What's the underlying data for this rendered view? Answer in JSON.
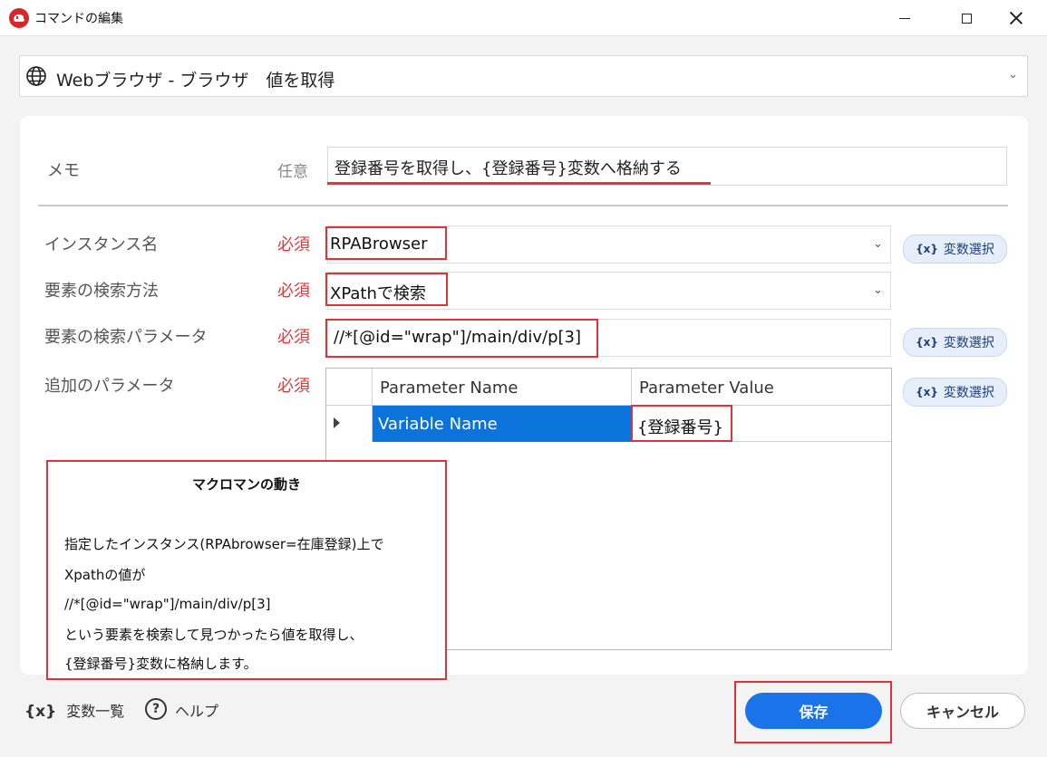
{
  "window": {
    "title": "コマンドの編集"
  },
  "command": {
    "label": "Webブラウザ - ブラウザ　値を取得"
  },
  "memo": {
    "label": "メモ",
    "badge": "任意",
    "value": "登録番号を取得し、{登録番号}変数へ格納する"
  },
  "fields": [
    {
      "label": "インスタンス名",
      "badge": "必須",
      "value": "RPABrowser"
    },
    {
      "label": "要素の検索方法",
      "badge": "必須",
      "value": "XPathで検索"
    },
    {
      "label": "要素の検索パラメータ",
      "badge": "必須",
      "value": "//*[@id=\"wrap\"]/main/div/p[3]"
    },
    {
      "label": "追加のパラメータ",
      "badge": "必須"
    }
  ],
  "var_button": {
    "icon": "{x}",
    "label": "変数選択"
  },
  "grid": {
    "headers": [
      "Parameter Name",
      "Parameter Value"
    ],
    "rows": [
      {
        "name": "Variable Name",
        "value": "{登録番号}"
      }
    ]
  },
  "note": {
    "title": "マクロマンの動き",
    "lines": [
      "指定したインスタンス(RPAbrowser=在庫登録)上で",
      "Xpathの値が",
      "//*[@id=\"wrap\"]/main/div/p[3]",
      "という要素を検索して見つかったら値を取得し、",
      "{登録番号}変数に格納します。"
    ]
  },
  "footer": {
    "var_list_icon": "{x}",
    "var_list_label": "変数一覧",
    "help_icon": "?",
    "help_label": "ヘルプ",
    "save_label": "保存",
    "cancel_label": "キャンセル"
  },
  "colors": {
    "accent": "#1a73e8",
    "required": "#e0393e",
    "highlight_box": "#e0323a",
    "selected_cell": "#0a74da"
  }
}
